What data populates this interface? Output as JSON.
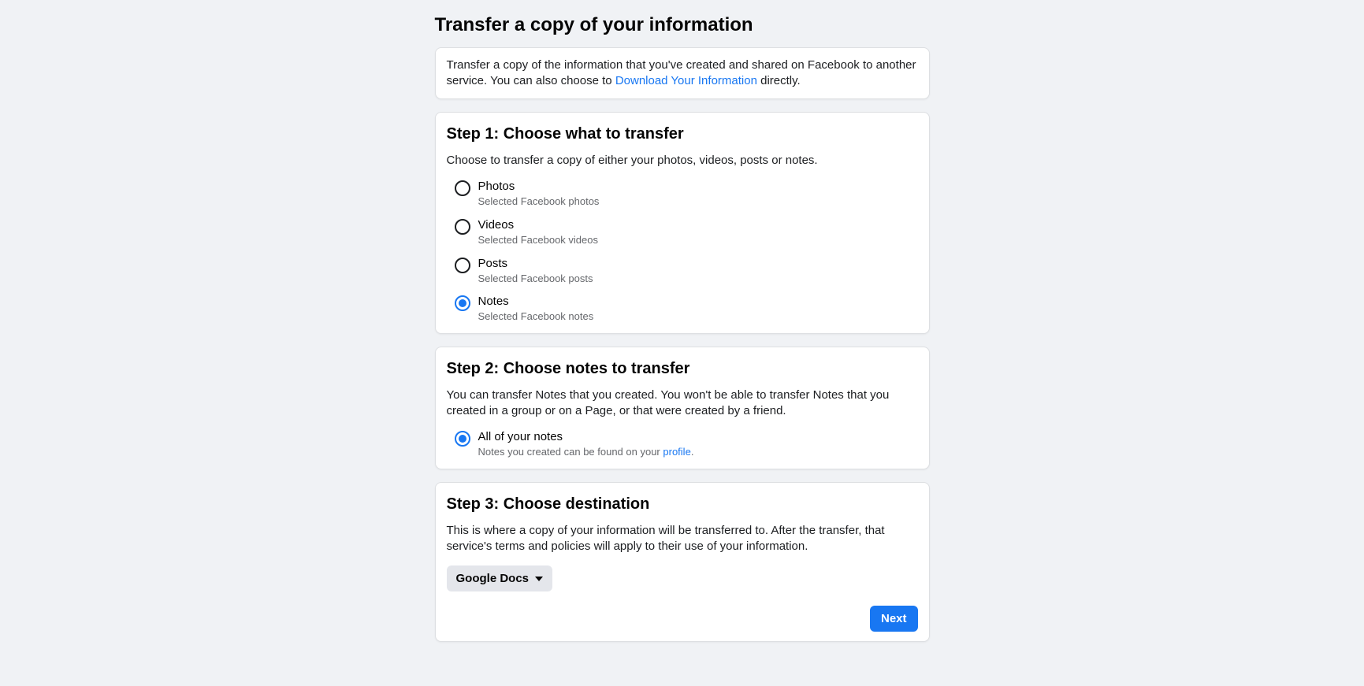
{
  "page": {
    "title": "Transfer a copy of your information"
  },
  "intro": {
    "text_before": "Transfer a copy of the information that you've created and shared on Facebook to another service. You can also choose to ",
    "link_label": "Download Your Information",
    "text_after": " directly."
  },
  "step1": {
    "title": "Step 1: Choose what to transfer",
    "description": "Choose to transfer a copy of either your photos, videos, posts or notes.",
    "selected_index": 3,
    "options": [
      {
        "label": "Photos",
        "sub": "Selected Facebook photos"
      },
      {
        "label": "Videos",
        "sub": "Selected Facebook videos"
      },
      {
        "label": "Posts",
        "sub": "Selected Facebook posts"
      },
      {
        "label": "Notes",
        "sub": "Selected Facebook notes"
      }
    ]
  },
  "step2": {
    "title": "Step 2: Choose notes to transfer",
    "description": "You can transfer Notes that you created. You won't be able to transfer Notes that you created in a group or on a Page, or that were created by a friend.",
    "selected_index": 0,
    "options": [
      {
        "label": "All of your notes",
        "sub_before": "Notes you created can be found on your ",
        "link_label": "profile",
        "sub_after": "."
      }
    ]
  },
  "step3": {
    "title": "Step 3: Choose destination",
    "description": "This is where a copy of your information will be transferred to. After the transfer, that service's terms and policies will apply to their use of your information.",
    "selected_destination": "Google Docs",
    "next_button_label": "Next"
  }
}
